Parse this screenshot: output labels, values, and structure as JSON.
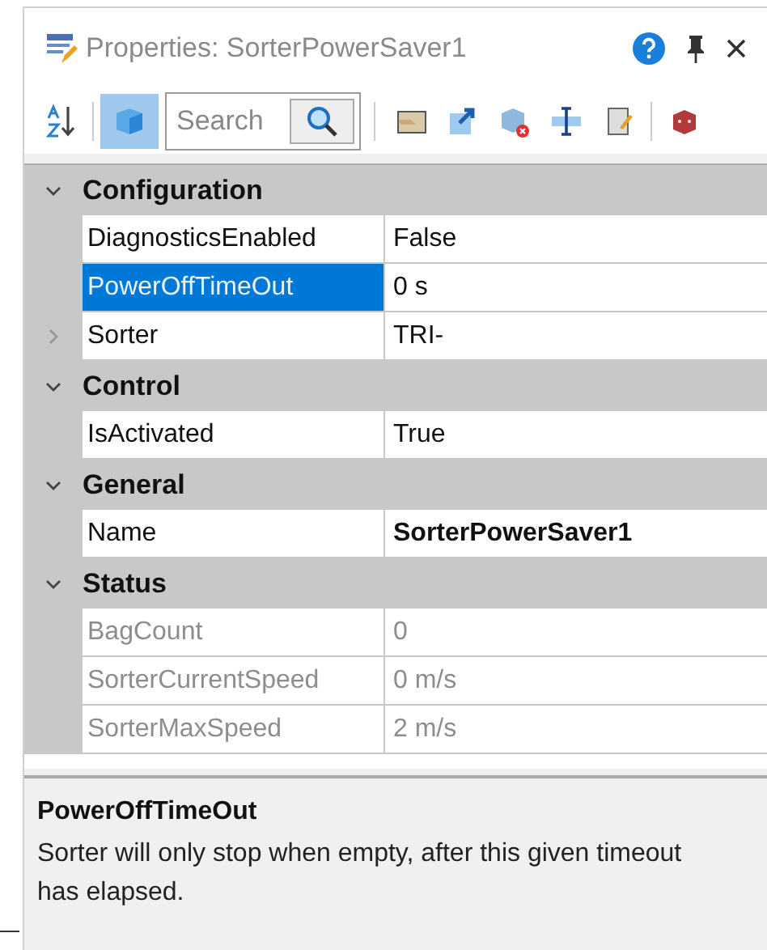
{
  "window": {
    "title": "Properties: SorterPowerSaver1"
  },
  "toolbar": {
    "sort_selected": false,
    "categorized_selected": true,
    "search": {
      "placeholder": "Search"
    }
  },
  "categories": [
    {
      "name": "Configuration",
      "expanded": true,
      "properties": [
        {
          "name": "DiagnosticsEnabled",
          "value": "False",
          "selected": false,
          "disabled": false,
          "bold": false,
          "expandable": false
        },
        {
          "name": "PowerOffTimeOut",
          "value": "0 s",
          "selected": true,
          "disabled": false,
          "bold": false,
          "expandable": false
        },
        {
          "name": "Sorter",
          "value": "TRI-",
          "selected": false,
          "disabled": false,
          "bold": false,
          "expandable": true
        }
      ]
    },
    {
      "name": "Control",
      "expanded": true,
      "properties": [
        {
          "name": "IsActivated",
          "value": "True",
          "selected": false,
          "disabled": false,
          "bold": false,
          "expandable": false
        }
      ]
    },
    {
      "name": "General",
      "expanded": true,
      "properties": [
        {
          "name": "Name",
          "value": "SorterPowerSaver1",
          "selected": false,
          "disabled": false,
          "bold": true,
          "expandable": false
        }
      ]
    },
    {
      "name": "Status",
      "expanded": true,
      "properties": [
        {
          "name": "BagCount",
          "value": "0",
          "selected": false,
          "disabled": true,
          "bold": false,
          "expandable": false
        },
        {
          "name": "SorterCurrentSpeed",
          "value": "0 m/s",
          "selected": false,
          "disabled": true,
          "bold": false,
          "expandable": false
        },
        {
          "name": "SorterMaxSpeed",
          "value": "2 m/s",
          "selected": false,
          "disabled": true,
          "bold": false,
          "expandable": false
        }
      ]
    }
  ],
  "description": {
    "title": "PowerOffTimeOut",
    "text": "Sorter will only stop when empty, after this given timeout has elapsed."
  }
}
